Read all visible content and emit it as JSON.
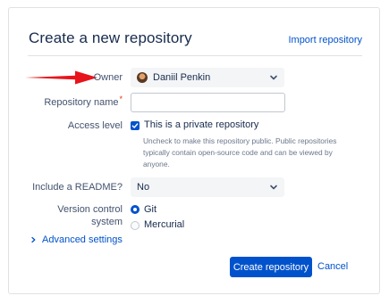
{
  "header": {
    "title": "Create a new repository",
    "import_link": "Import repository"
  },
  "form": {
    "owner": {
      "label": "Owner",
      "value": "Daniil Penkin"
    },
    "repo_name": {
      "label": "Repository name",
      "required_marker": "*",
      "value": ""
    },
    "access": {
      "label": "Access level",
      "checkbox_label": "This is a private repository",
      "checked": true,
      "help": "Uncheck to make this repository public. Public repositories typically contain open-source code and can be viewed by anyone."
    },
    "readme": {
      "label": "Include a README?",
      "value": "No"
    },
    "vcs": {
      "label_line1": "Version control",
      "label_line2": "system",
      "options": [
        {
          "label": "Git",
          "selected": true
        },
        {
          "label": "Mercurial",
          "selected": false
        }
      ]
    },
    "advanced": {
      "label": "Advanced settings"
    }
  },
  "actions": {
    "create_label": "Create repository",
    "cancel_label": "Cancel"
  },
  "colors": {
    "accent": "#0052cc",
    "annotation_arrow": "#e8141b"
  },
  "icons": {
    "select_chevron": "chevron-down-icon",
    "advanced_chevron": "chevron-right-icon",
    "checkbox_check": "check-icon",
    "annotation": "red-arrow-icon"
  }
}
